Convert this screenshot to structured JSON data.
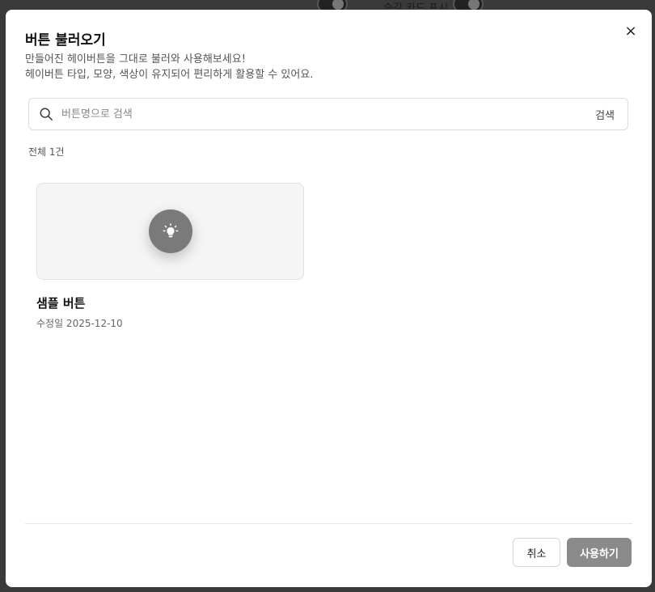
{
  "background": {
    "label": "숨김 카드 표시"
  },
  "modal": {
    "title": "버튼 불러오기",
    "description_line1": "만들어진 헤이버튼을 그대로 불러와 사용해보세요!",
    "description_line2": "헤이버튼 타입, 모양, 색상이 유지되어 편리하게 활용할 수 있어요.",
    "close_label": "×"
  },
  "search": {
    "placeholder": "버튼명으로 검색",
    "value": "",
    "button_label": "검색"
  },
  "list": {
    "total_label": "전체 1건",
    "items": [
      {
        "name": "샘플 버튼",
        "modified": "수정일 2025-12-10",
        "icon": "lightbulb-icon"
      }
    ]
  },
  "footer": {
    "cancel_label": "취소",
    "use_label": "사용하기"
  },
  "colors": {
    "primary_disabled": "#8a8a8a",
    "icon_circle": "#7a7a7a"
  }
}
